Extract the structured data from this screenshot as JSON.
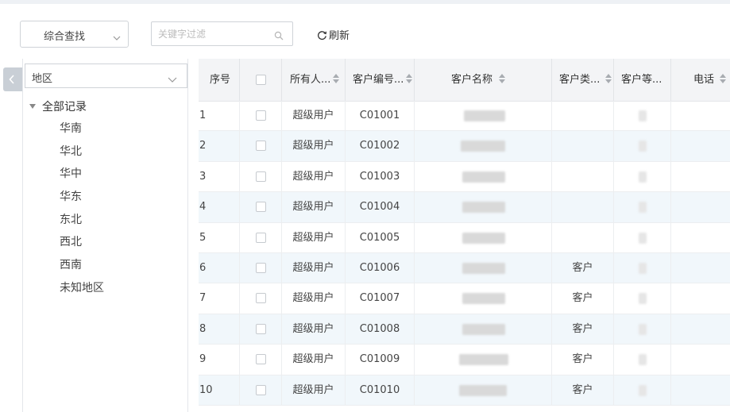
{
  "toolbar": {
    "combo_search_label": "综合查找",
    "keyword_placeholder": "关键字过滤",
    "refresh_label": "刷新"
  },
  "sidebar": {
    "region_select_value": "地区",
    "tree_root_label": "全部记录",
    "regions": [
      "华南",
      "华北",
      "华中",
      "华东",
      "东北",
      "西北",
      "西南",
      "未知地区"
    ]
  },
  "table": {
    "columns": {
      "index": "序号",
      "owner": "所有人...",
      "customer_code": "客户编号...",
      "customer_name": "客户名称",
      "customer_type": "客户类...",
      "customer_level": "客户等...",
      "phone": "电话"
    },
    "rows": [
      {
        "index": "1",
        "owner": "超级用户",
        "code": "C01001",
        "type": ""
      },
      {
        "index": "2",
        "owner": "超级用户",
        "code": "C01002",
        "type": ""
      },
      {
        "index": "3",
        "owner": "超级用户",
        "code": "C01003",
        "type": ""
      },
      {
        "index": "4",
        "owner": "超级用户",
        "code": "C01004",
        "type": ""
      },
      {
        "index": "5",
        "owner": "超级用户",
        "code": "C01005",
        "type": ""
      },
      {
        "index": "6",
        "owner": "超级用户",
        "code": "C01006",
        "type": "客户"
      },
      {
        "index": "7",
        "owner": "超级用户",
        "code": "C01007",
        "type": "客户"
      },
      {
        "index": "8",
        "owner": "超级用户",
        "code": "C01008",
        "type": "客户"
      },
      {
        "index": "9",
        "owner": "超级用户",
        "code": "C01009",
        "type": "客户"
      },
      {
        "index": "10",
        "owner": "超级用户",
        "code": "C01010",
        "type": "客户"
      }
    ]
  },
  "icons": {
    "combo_chevron": "chevron-down-icon",
    "search": "search-icon",
    "refresh": "refresh-icon",
    "collapse": "chevron-left-icon",
    "region_chevron": "chevron-down-icon",
    "tree_caret": "caret-down-icon",
    "sort": "sort-icon"
  },
  "colors": {
    "alt_row": "#f1f7fb",
    "header_bg": "#f3f4f6",
    "collapse_tab": "#c9cfd6"
  }
}
